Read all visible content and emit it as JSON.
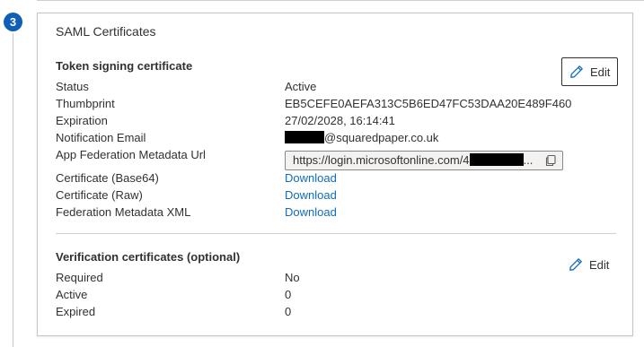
{
  "step": {
    "number": "3"
  },
  "card": {
    "title": "SAML Certificates"
  },
  "token_signing": {
    "title": "Token signing certificate",
    "edit_label": "Edit",
    "rows": [
      {
        "label": "Status",
        "value": "Active"
      },
      {
        "label": "Thumbprint",
        "value": "EB5CEFE0AEFA313C5B6ED47FC53DAA20E489F460"
      },
      {
        "label": "Expiration",
        "value": "27/02/2028, 16:14:41"
      },
      {
        "label": "Notification Email",
        "value": "@squaredpaper.co.uk"
      },
      {
        "label": "App Federation Metadata Url",
        "value_prefix": "https://login.microsoftonline.com/4",
        "value_suffix": "..."
      },
      {
        "label": "Certificate (Base64)",
        "value": "Download"
      },
      {
        "label": "Certificate (Raw)",
        "value": "Download"
      },
      {
        "label": "Federation Metadata XML",
        "value": "Download"
      }
    ]
  },
  "verification": {
    "title": "Verification certificates (optional)",
    "edit_label": "Edit",
    "rows": [
      {
        "label": "Required",
        "value": "No"
      },
      {
        "label": "Active",
        "value": "0"
      },
      {
        "label": "Expired",
        "value": "0"
      }
    ]
  },
  "colors": {
    "link": "#0f6cbd",
    "badge": "#0f5eb7"
  },
  "icons": {
    "edit": "pencil-icon",
    "copy": "copy-icon"
  }
}
